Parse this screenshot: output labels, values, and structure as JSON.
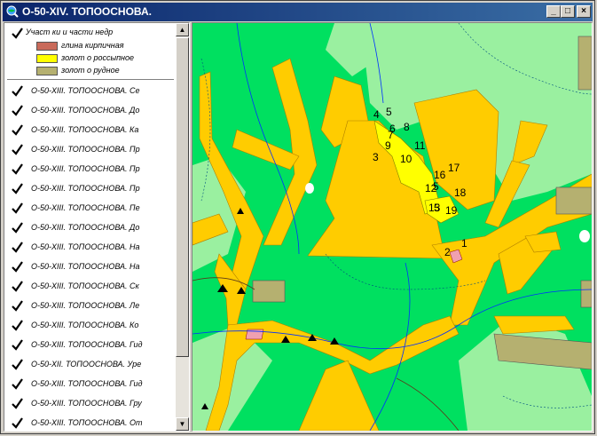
{
  "window": {
    "title": "O-50-XIV. ТОПООСНОВА."
  },
  "titlebar": {
    "minimize": "_",
    "maximize": "□",
    "close": "×"
  },
  "legend": {
    "title": "Участ ки и части недр",
    "items": [
      {
        "label": "глина кирпичная",
        "color": "#c96a5a"
      },
      {
        "label": "золот о россыпное",
        "color": "#ffff00"
      },
      {
        "label": "золот о рудное",
        "color": "#b5b070"
      }
    ]
  },
  "layers": [
    "O-50-XIII. ТОПООСНОВА. Се",
    "O-50-XIII. ТОПООСНОВА. До",
    "O-50-XIII. ТОПООСНОВА. Ка",
    "O-50-XIII. ТОПООСНОВА. Пр",
    "O-50-XIII. ТОПООСНОВА. Пр",
    "O-50-XIII. ТОПООСНОВА. Пр",
    "O-50-XIII. ТОПООСНОВА. Пе",
    "O-50-XIII. ТОПООСНОВА. До",
    "O-50-XIII. ТОПООСНОВА. На",
    "O-50-XIII. ТОПООСНОВА. На",
    "O-50-XIII. ТОПООСНОВА. Ск",
    "O-50-XIII. ТОПООСНОВА. Ле",
    "O-50-XIII. ТОПООСНОВА. Ко",
    "O-50-XIII. ТОПООСНОВА. Гид",
    "O-50-XII. ТОПООСНОВА. Уре",
    "O-50-XIII. ТОПООСНОВА. Гид",
    "O-50-XIII. ТОПООСНОВА. Гру",
    "O-50-XIII. ТОПООСНОВА. От"
  ],
  "scrollbar": {
    "up": "▲",
    "down": "▼"
  },
  "map_labels": {
    "n1": "1",
    "n2": "2",
    "n3": "3",
    "n4": "4",
    "n5": "5",
    "n6": "6",
    "n7": "7",
    "n8": "8",
    "n9": "9",
    "n10": "10",
    "n11": "11",
    "n12": "12",
    "n13": "13",
    "n16": "16",
    "n17": "17",
    "n18": "18",
    "n19": "19",
    "n5b": "5",
    "n5c": "5"
  },
  "colors": {
    "forest": "#00e060",
    "light_forest": "#9af0a0",
    "ore_gold": "#b5b070",
    "placer_gold": "#ffff00",
    "clay": "#c96a5a",
    "valley": "#ffcc00",
    "titlebar": "#0a246a"
  }
}
